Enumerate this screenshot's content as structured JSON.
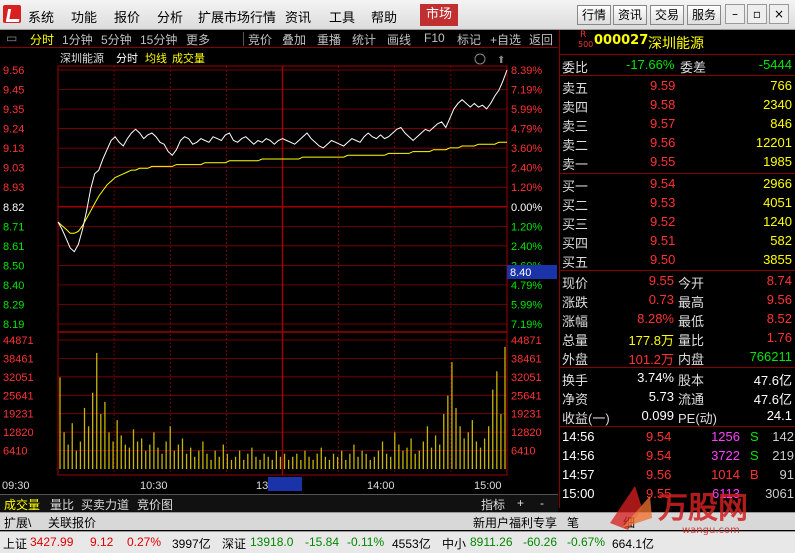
{
  "menu": {
    "items": [
      "系统",
      "功能",
      "报价",
      "分析",
      "扩展市场行情",
      "资讯",
      "工具",
      "帮助"
    ],
    "market": "市场",
    "right_buttons": [
      "行情",
      "资讯",
      "交易",
      "服务"
    ]
  },
  "chart_toolbar": {
    "items": [
      "分时",
      "1分钟",
      "5分钟",
      "15分钟",
      "更多",
      "竞价",
      "叠加",
      "重播",
      "统计",
      "画线",
      "F10",
      "标记",
      "+自选",
      "返回"
    ]
  },
  "chart_header": {
    "name": "深圳能源",
    "mode": "分时",
    "avg": "均线",
    "vol": "成交量"
  },
  "colors": {
    "up": "#ff3232",
    "down": "#00e600",
    "avg": "#ffff00",
    "price": "#ffffff",
    "grid": "#a00000",
    "volume": "#c8b400"
  },
  "price_axis": {
    "left": [
      "9.56",
      "9.45",
      "9.35",
      "9.24",
      "9.13",
      "9.03",
      "8.93",
      "8.82",
      "8.71",
      "8.61",
      "8.50",
      "8.40",
      "8.29",
      "8.19"
    ],
    "right": [
      "8.39%",
      "7.19%",
      "5.99%",
      "4.79%",
      "3.60%",
      "2.40%",
      "1.20%",
      "0.00%",
      "1.20%",
      "2.40%",
      "3.60%",
      "4.79%",
      "5.99%",
      "7.19%"
    ],
    "cursor_value": "8.40"
  },
  "volume_axis": {
    "labels": [
      "44871",
      "38461",
      "32051",
      "25641",
      "19231",
      "12820",
      "6410"
    ]
  },
  "time_axis": {
    "labels": [
      "09:30",
      "10:30",
      "13",
      "13:09",
      "14:00",
      "15:00"
    ]
  },
  "chart_data": {
    "type": "line",
    "x_range": [
      "09:30",
      "15:00"
    ],
    "ylim": [
      8.19,
      9.56
    ],
    "prev_close": 8.82,
    "series": [
      {
        "values": [
          8.74,
          8.7,
          8.65,
          8.6,
          8.58,
          8.62,
          8.7,
          8.8,
          8.92,
          9.0,
          9.02,
          9.08,
          9.13,
          9.18,
          9.2,
          9.17,
          9.15,
          9.19,
          9.22,
          9.24,
          9.22,
          9.19,
          9.21,
          9.22,
          9.2,
          9.17,
          9.16,
          9.12,
          9.1,
          9.13,
          9.18,
          9.2,
          9.19,
          9.16,
          9.17,
          9.19,
          9.18,
          9.17,
          9.2,
          9.19,
          9.18,
          9.21,
          9.22,
          9.18,
          9.17,
          9.19,
          9.2,
          9.18,
          9.16,
          9.18,
          9.17,
          9.19,
          9.18,
          9.16,
          9.18,
          9.19,
          9.18,
          9.17,
          9.16,
          9.18,
          9.2,
          9.22,
          9.19,
          9.17,
          9.15,
          9.14,
          9.16,
          9.18,
          9.17,
          9.16,
          9.15,
          9.17,
          9.19,
          9.18,
          9.17,
          9.2,
          9.22,
          9.2,
          9.19,
          9.21,
          9.19,
          9.2,
          9.22,
          9.24,
          9.25,
          9.22,
          9.2,
          9.18,
          9.2,
          9.22,
          9.24,
          9.23,
          9.25,
          9.27,
          9.28,
          9.25,
          9.3,
          9.35,
          9.38,
          9.4,
          9.38,
          9.36,
          9.38,
          9.36,
          9.37,
          9.35,
          9.38,
          9.42,
          9.45,
          9.5,
          9.56
        ]
      },
      {
        "values": [
          8.74,
          8.72,
          8.7,
          8.68,
          8.68,
          8.69,
          8.72,
          8.76,
          8.8,
          8.84,
          8.88,
          8.91,
          8.94,
          8.96,
          8.98,
          8.99,
          9.0,
          9.01,
          9.02,
          9.02,
          9.03,
          9.03,
          9.03,
          9.04,
          9.04,
          9.04,
          9.04,
          9.04,
          9.04,
          9.05,
          9.05,
          9.05,
          9.05,
          9.05,
          9.05,
          9.05,
          9.06,
          9.06,
          9.06,
          9.06,
          9.06,
          9.06,
          9.07,
          9.07,
          9.07,
          9.07,
          9.07,
          9.07,
          9.07,
          9.07,
          9.08,
          9.08,
          9.08,
          9.08,
          9.08,
          9.08,
          9.08,
          9.08,
          9.08,
          9.08,
          9.09,
          9.09,
          9.09,
          9.09,
          9.09,
          9.09,
          9.09,
          9.09,
          9.09,
          9.09,
          9.09,
          9.1,
          9.1,
          9.1,
          9.1,
          9.1,
          9.1,
          9.1,
          9.1,
          9.1,
          9.1,
          9.11,
          9.11,
          9.11,
          9.11,
          9.11,
          9.11,
          9.12,
          9.12,
          9.12,
          9.12,
          9.12,
          9.13,
          9.13,
          9.13,
          9.13,
          9.14,
          9.14,
          9.14,
          9.15,
          9.15,
          9.15,
          9.15,
          9.16,
          9.16,
          9.16,
          9.16,
          9.16,
          9.17,
          9.17,
          9.17
        ]
      }
    ],
    "volume": [
      30000,
      12000,
      8000,
      15000,
      6000,
      9000,
      20000,
      14000,
      25000,
      38000,
      18000,
      22000,
      12000,
      9000,
      16000,
      11000,
      8000,
      7000,
      13000,
      9000,
      10000,
      6000,
      8000,
      12000,
      7000,
      5000,
      9000,
      14000,
      6000,
      8000,
      10000,
      5000,
      7000,
      4000,
      6000,
      9000,
      5000,
      3000,
      6000,
      4000,
      8000,
      5000,
      3000,
      4000,
      6000,
      3000,
      5000,
      7000,
      4000,
      3000,
      5000,
      4000,
      3000,
      6000,
      4000,
      5000,
      3000,
      4000,
      5000,
      3000,
      6000,
      4000,
      3000,
      5000,
      7000,
      4000,
      3000,
      5000,
      4000,
      6000,
      3000,
      5000,
      8000,
      4000,
      6000,
      5000,
      3000,
      4000,
      6000,
      9000,
      5000,
      4000,
      12000,
      8000,
      6000,
      7000,
      10000,
      5000,
      6000,
      9000,
      14000,
      7000,
      11000,
      8000,
      18000,
      24000,
      35000,
      20000,
      14000,
      10000,
      12000,
      16000,
      9000,
      7000,
      10000,
      14000,
      26000,
      32000,
      18000,
      40000
    ]
  },
  "stock": {
    "code": "000027",
    "name": "深圳能源",
    "r_label": "R",
    "r_sub": "500"
  },
  "quote": {
    "weibi_label": "委比",
    "weibi": "-17.66%",
    "weicha_label": "委差",
    "weicha": "-5444",
    "asks": [
      {
        "label": "卖五",
        "price": "9.59",
        "vol": "766"
      },
      {
        "label": "卖四",
        "price": "9.58",
        "vol": "2340"
      },
      {
        "label": "卖三",
        "price": "9.57",
        "vol": "846"
      },
      {
        "label": "卖二",
        "price": "9.56",
        "vol": "12201"
      },
      {
        "label": "卖一",
        "price": "9.55",
        "vol": "1985"
      }
    ],
    "bids": [
      {
        "label": "买一",
        "price": "9.54",
        "vol": "2966"
      },
      {
        "label": "买二",
        "price": "9.53",
        "vol": "4051"
      },
      {
        "label": "买三",
        "price": "9.52",
        "vol": "1240"
      },
      {
        "label": "买四",
        "price": "9.51",
        "vol": "582"
      },
      {
        "label": "买五",
        "price": "9.50",
        "vol": "3855"
      }
    ],
    "stats": [
      {
        "l1": "现价",
        "v1": "9.55",
        "l2": "今开",
        "v2": "8.74"
      },
      {
        "l1": "涨跌",
        "v1": "0.73",
        "l2": "最高",
        "v2": "9.56"
      },
      {
        "l1": "涨幅",
        "v1": "8.28%",
        "l2": "最低",
        "v2": "8.52"
      },
      {
        "l1": "总量",
        "v1": "177.8万",
        "l2": "量比",
        "v2": "1.76"
      },
      {
        "l1": "外盘",
        "v1": "101.2万",
        "l2": "内盘",
        "v2": "766211"
      }
    ],
    "finance": [
      {
        "l1": "换手",
        "v1": "3.74%",
        "l2": "股本",
        "v2": "47.6亿"
      },
      {
        "l1": "净资",
        "v1": "5.73",
        "l2": "流通",
        "v2": "47.6亿"
      },
      {
        "l1": "收益(一)",
        "v1": "0.099",
        "l2": "PE(动)",
        "v2": "24.1"
      }
    ],
    "ticks": [
      {
        "time": "14:56",
        "price": "9.54",
        "vol": "1256",
        "dir": "S",
        "n": "142"
      },
      {
        "time": "14:56",
        "price": "9.54",
        "vol": "3722",
        "dir": "S",
        "n": "219"
      },
      {
        "time": "14:57",
        "price": "9.56",
        "vol": "1014",
        "dir": "B",
        "n": "91"
      },
      {
        "time": "15:00",
        "price": "9.55",
        "vol": "6113",
        "dir": "",
        "n": "3061"
      }
    ]
  },
  "bottom_tabs": [
    "成交量",
    "量比",
    "买卖力道",
    "竞价图"
  ],
  "bottom_right": {
    "indicator": "指标",
    "plus": "+",
    "minus": "-"
  },
  "ext_bar": {
    "items": [
      "扩展\\",
      "关联报价"
    ],
    "right": "新用户福利专享",
    "right2": "笔",
    "right3": "细"
  },
  "status": {
    "sh_label": "上证",
    "sh_val": "3427.99",
    "sh_chg": "9.12",
    "sh_pct": "0.27%",
    "sh_amt": "3997亿",
    "sz_label": "深证",
    "sz_val": "13918.0",
    "sz_chg": "-15.84",
    "sz_pct": "-0.11%",
    "sz_amt": "4553亿",
    "zx_label": "中小",
    "zx_val": "8911.26",
    "zx_chg": "-60.26",
    "zx_pct": "-0.67%",
    "zx_amt": "664.1亿"
  },
  "watermark": {
    "text": "万股网",
    "sub": "wangu.com"
  }
}
